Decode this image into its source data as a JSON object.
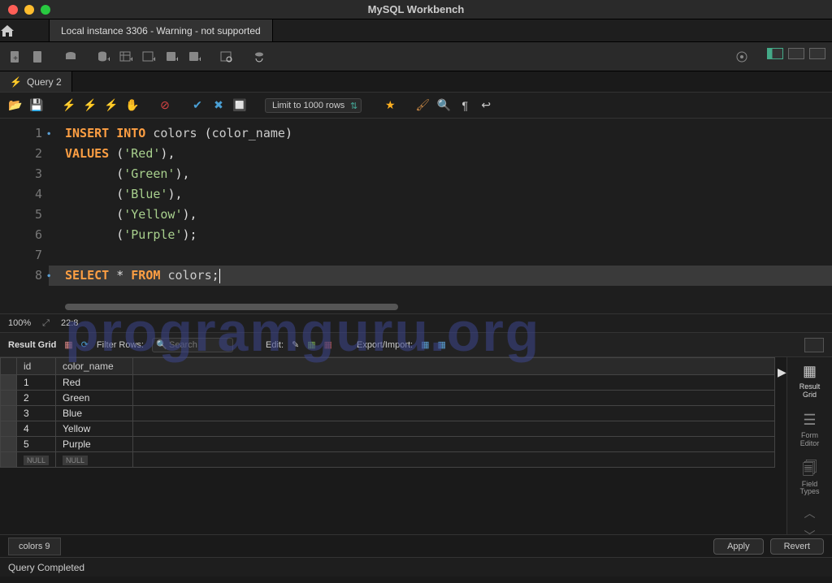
{
  "window": {
    "title": "MySQL Workbench"
  },
  "connection_tab": "Local instance 3306 - Warning - not supported",
  "query_tab": "Query 2",
  "limit_dropdown": "Limit to 1000 rows",
  "editor": {
    "lines": [
      {
        "n": "1",
        "dot": true
      },
      {
        "n": "2",
        "dot": false
      },
      {
        "n": "3",
        "dot": false
      },
      {
        "n": "4",
        "dot": false
      },
      {
        "n": "5",
        "dot": false
      },
      {
        "n": "6",
        "dot": false
      },
      {
        "n": "7",
        "dot": false
      },
      {
        "n": "8",
        "dot": true
      }
    ],
    "kw_insert": "INSERT",
    "kw_into": "INTO",
    "ident_colors": "colors",
    "open_paren": "(",
    "ident_colname": "color_name",
    "close_paren": ")",
    "kw_values": "VALUES",
    "val_red": "'Red'",
    "val_green": "'Green'",
    "val_blue": "'Blue'",
    "val_yellow": "'Yellow'",
    "val_purple": "'Purple'",
    "comma": ",",
    "semicolon": ";",
    "kw_select": "SELECT",
    "star": "*",
    "kw_from": "FROM",
    "zoom": "100%",
    "cursor_pos": "22:8"
  },
  "result_toolbar": {
    "label": "Result Grid",
    "filter_label": "Filter Rows:",
    "filter_placeholder": "Search",
    "edit_label": "Edit:",
    "export_label": "Export/Import:"
  },
  "grid": {
    "headers": {
      "id": "id",
      "name": "color_name"
    },
    "rows": [
      {
        "id": "1",
        "name": "Red"
      },
      {
        "id": "2",
        "name": "Green"
      },
      {
        "id": "3",
        "name": "Blue"
      },
      {
        "id": "4",
        "name": "Yellow"
      },
      {
        "id": "5",
        "name": "Purple"
      }
    ],
    "null": "NULL"
  },
  "side": {
    "result_grid": "Result\nGrid",
    "form_editor": "Form\nEditor",
    "field_types": "Field\nTypes"
  },
  "bottom": {
    "tab": "colors 9",
    "apply": "Apply",
    "revert": "Revert"
  },
  "status": "Query Completed",
  "watermark": "programguru.org"
}
